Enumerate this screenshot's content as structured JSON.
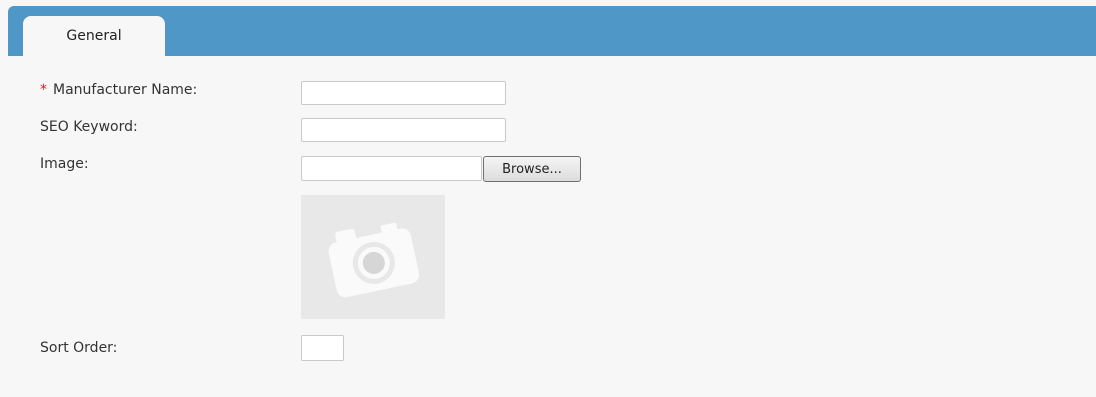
{
  "tabs": [
    {
      "label": "General",
      "active": true
    }
  ],
  "form": {
    "manufacturer_name": {
      "required_marker": "*",
      "label": "Manufacturer Name:",
      "value": ""
    },
    "seo_keyword": {
      "label": "SEO Keyword:",
      "value": ""
    },
    "image": {
      "label": "Image:",
      "value": "",
      "browse_label": "Browse...",
      "preview_icon": "camera-placeholder-icon"
    },
    "sort_order": {
      "label": "Sort Order:",
      "value": ""
    }
  },
  "colors": {
    "tab_bar": "#4e97c7",
    "background": "#f7f7f7",
    "required": "#e01b1b"
  }
}
